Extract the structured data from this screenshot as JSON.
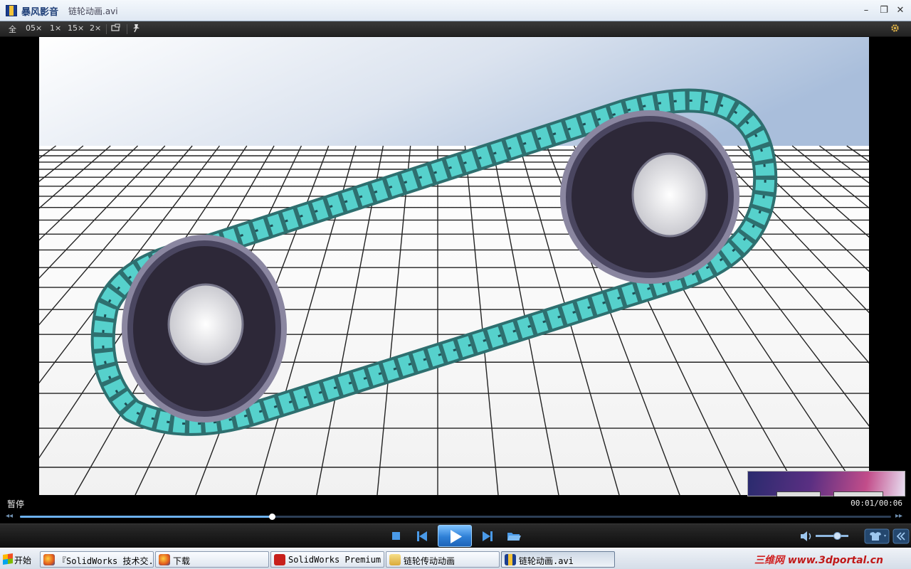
{
  "window": {
    "app_name": "暴风影音",
    "file_name": "链轮动画.avi",
    "minimize_glyph": "–",
    "restore_glyph": "❐",
    "close_glyph": "✕"
  },
  "toolbar": {
    "fullscreen_label": "全",
    "zoom_05_label": "05×",
    "zoom_1_label": "1×",
    "zoom_15_label": "15×",
    "zoom_2_label": "2×",
    "mini_icon": "mini-mode-icon",
    "pin_icon": "pin-icon",
    "settings_icon": "gear-icon"
  },
  "status": {
    "state": "暂停",
    "time": "00:01/00:06"
  },
  "playback": {
    "progress_fraction": 0.289,
    "volume_fraction": 0.65,
    "accent_color": "#6cb0ee"
  },
  "controls": {
    "stop_icon": "stop-icon",
    "prev_icon": "previous-icon",
    "play_icon": "play-icon",
    "next_icon": "next-icon",
    "open_icon": "open-folder-icon",
    "volume_icon": "speaker-icon",
    "skin_icon": "shirt-icon",
    "collapse_icon": "double-chevron-left-icon"
  },
  "taskbar": {
    "start_label": "开始",
    "tasks": [
      {
        "label": "『SolidWorks 技术交...",
        "icon": "firefox-icon"
      },
      {
        "label": "下载",
        "icon": "firefox-icon"
      },
      {
        "label": "SolidWorks Premium ...",
        "icon": "solidworks-icon"
      },
      {
        "label": "链轮传动动画",
        "icon": "folder-icon"
      },
      {
        "label": "链轮动画.avi",
        "icon": "player-icon"
      }
    ],
    "tray_brand": "三维网",
    "tray_site": "www.3dportal.cn"
  }
}
